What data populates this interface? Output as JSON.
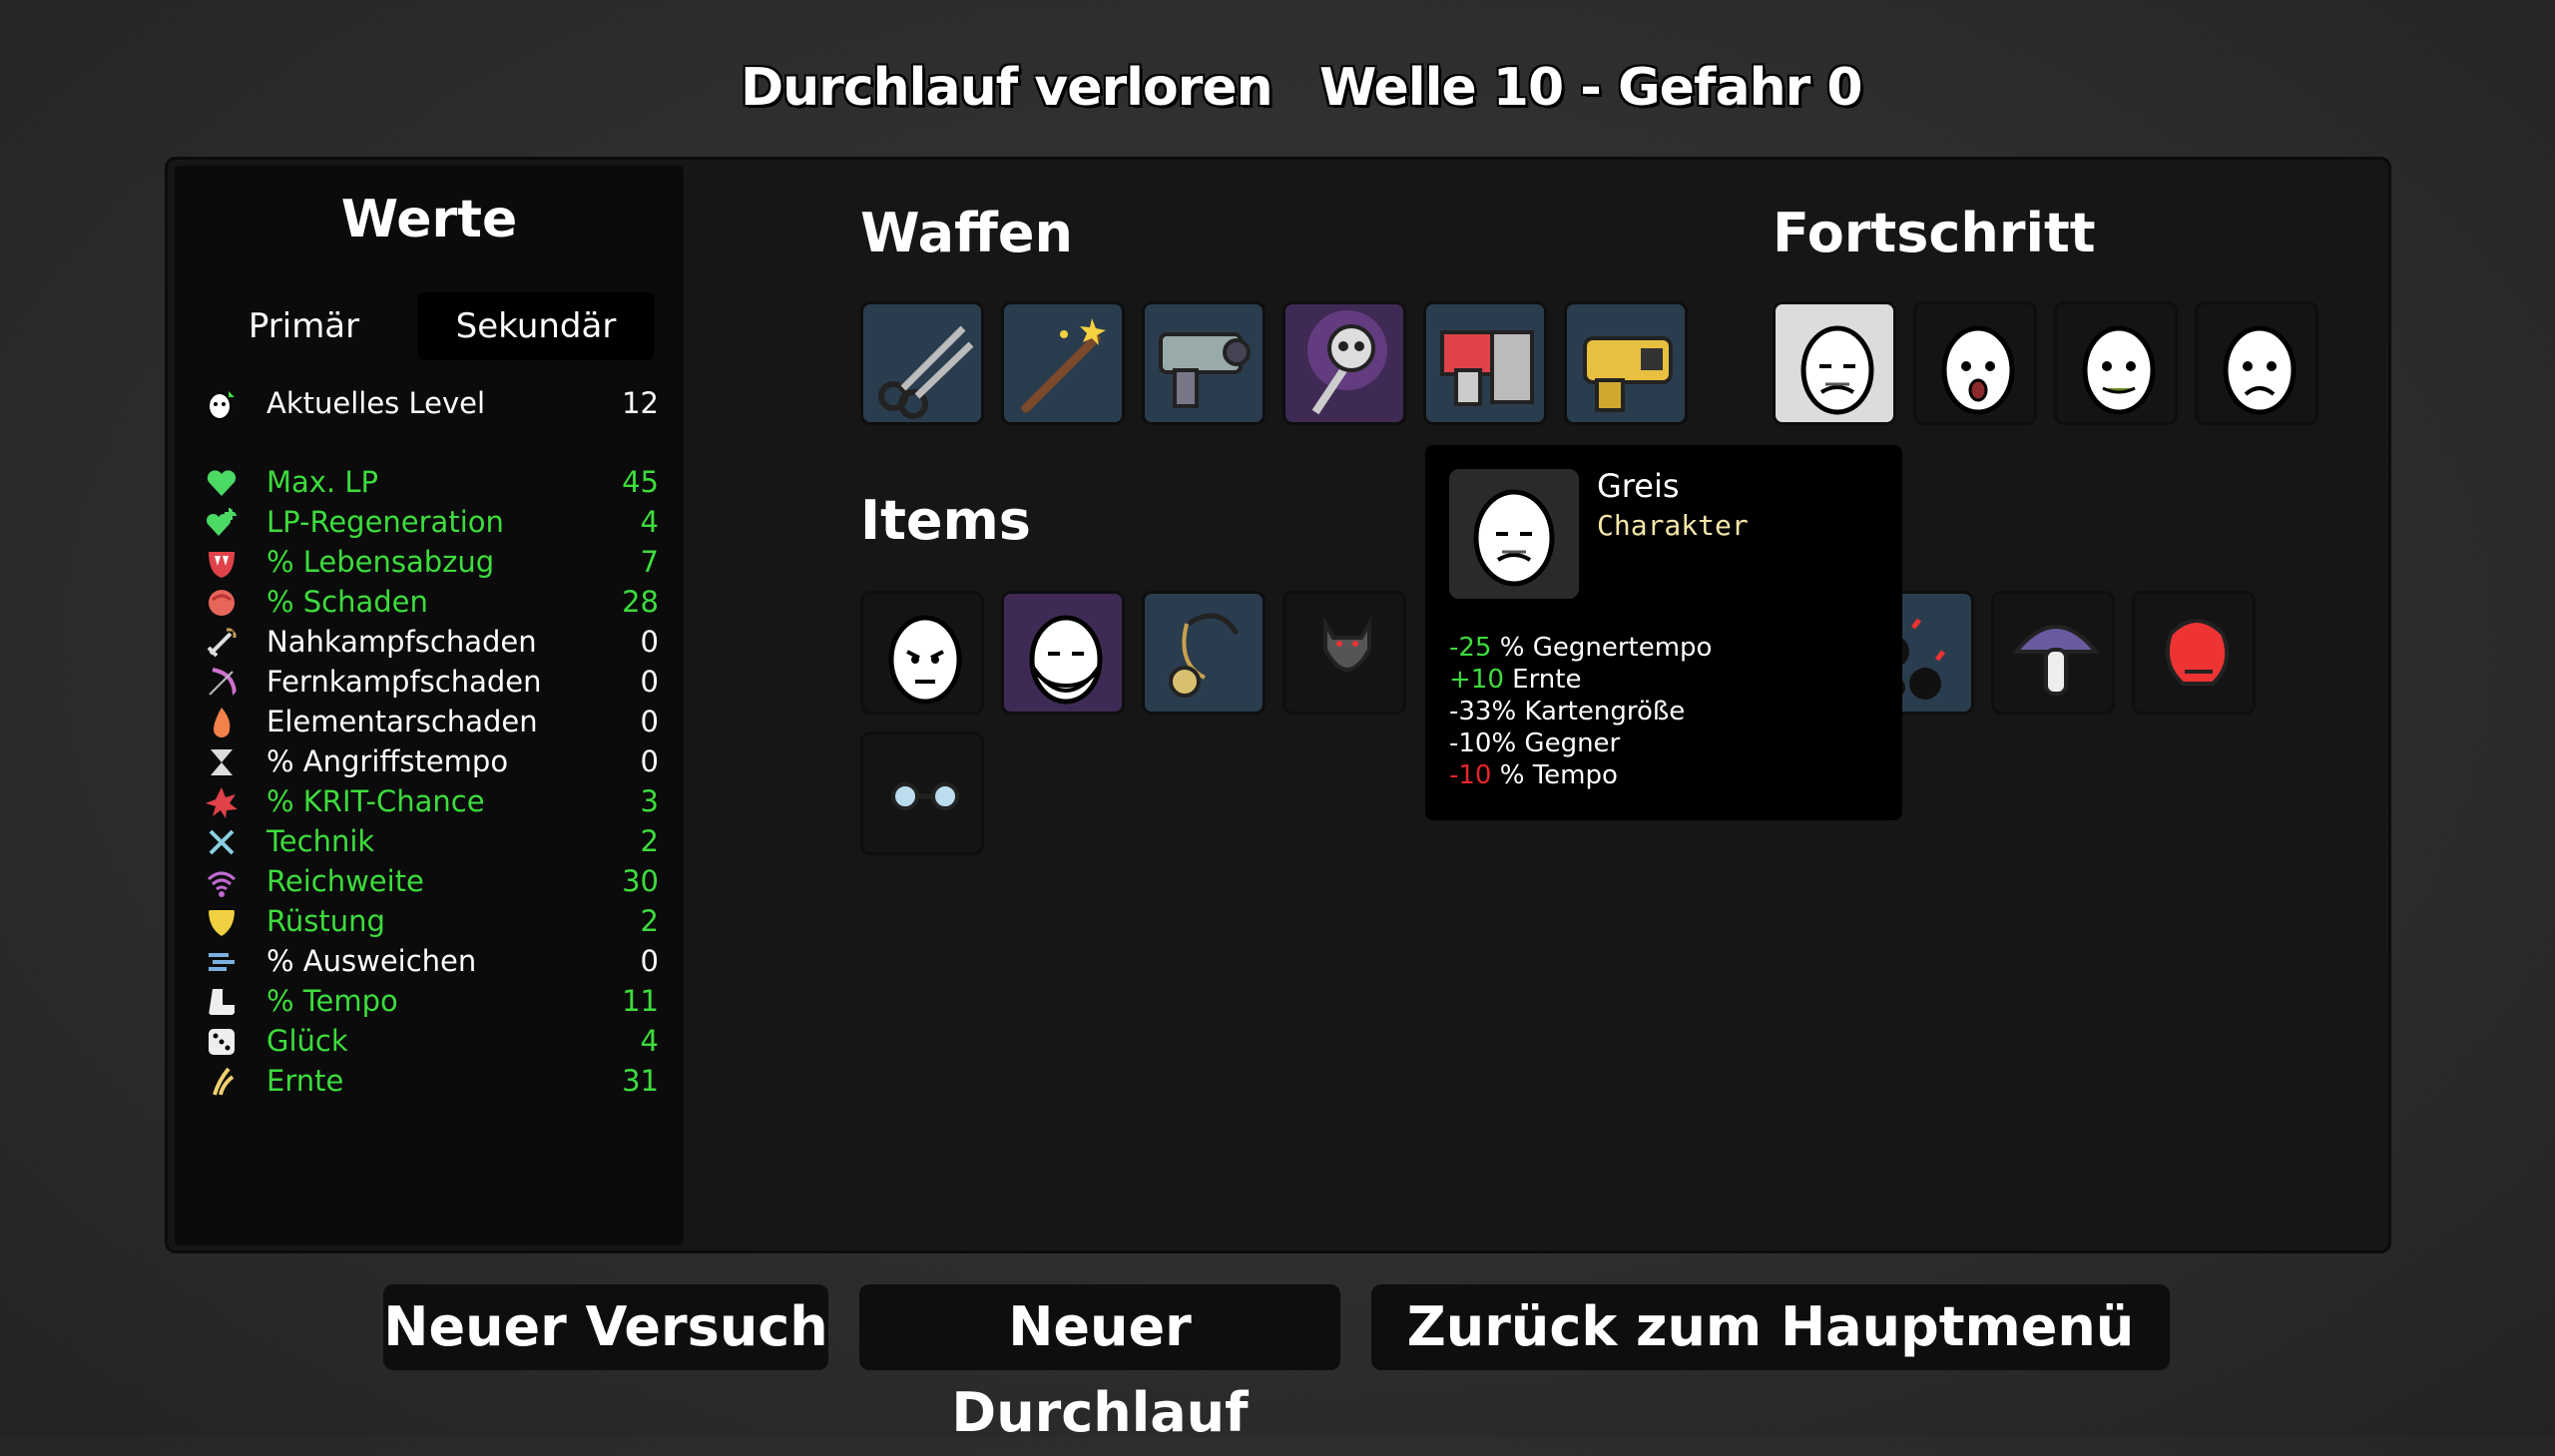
{
  "header": {
    "run_status": "Durchlauf verloren",
    "wave_info": "Welle 10 - Gefahr 0"
  },
  "stats": {
    "title": "Werte",
    "tabs": {
      "primary": "Primär",
      "secondary": "Sekundär"
    },
    "level": {
      "label": "Aktuelles Level",
      "value": "12"
    },
    "rows": [
      {
        "icon": "heart-icon",
        "label": "Max. LP",
        "value": "45",
        "highlight": true
      },
      {
        "icon": "hp-regen-icon",
        "label": "LP-Regeneration",
        "value": "4",
        "highlight": true
      },
      {
        "icon": "fang-icon",
        "label": "% Lebensabzug",
        "value": "7",
        "highlight": true
      },
      {
        "icon": "muscle-icon",
        "label": "% Schaden",
        "value": "28",
        "highlight": true
      },
      {
        "icon": "sword-icon",
        "label": "Nahkampfschaden",
        "value": "0",
        "highlight": false
      },
      {
        "icon": "bow-icon",
        "label": "Fernkampfschaden",
        "value": "0",
        "highlight": false
      },
      {
        "icon": "flame-icon",
        "label": "Elementarschaden",
        "value": "0",
        "highlight": false
      },
      {
        "icon": "hourglass-icon",
        "label": "% Angriffstempo",
        "value": "0",
        "highlight": false
      },
      {
        "icon": "crit-icon",
        "label": "% KRIT-Chance",
        "value": "3",
        "highlight": true
      },
      {
        "icon": "wrench-icon",
        "label": "Technik",
        "value": "2",
        "highlight": true
      },
      {
        "icon": "range-icon",
        "label": "Reichweite",
        "value": "30",
        "highlight": true
      },
      {
        "icon": "shield-icon",
        "label": "Rüstung",
        "value": "2",
        "highlight": true
      },
      {
        "icon": "dodge-icon",
        "label": "% Ausweichen",
        "value": "0",
        "highlight": false
      },
      {
        "icon": "boot-icon",
        "label": "% Tempo",
        "value": "11",
        "highlight": true
      },
      {
        "icon": "dice-icon",
        "label": "Glück",
        "value": "4",
        "highlight": true
      },
      {
        "icon": "harvest-icon",
        "label": "Ernte",
        "value": "31",
        "highlight": true
      }
    ]
  },
  "weapons": {
    "title": "Waffen",
    "items": [
      {
        "icon": "scissors-icon",
        "tier": "blue"
      },
      {
        "icon": "wand-icon",
        "tier": "blue"
      },
      {
        "icon": "blaster-icon",
        "tier": "blue"
      },
      {
        "icon": "skull-staff-icon",
        "tier": "purple"
      },
      {
        "icon": "nail-gun-icon",
        "tier": "blue"
      },
      {
        "icon": "taser-icon",
        "tier": "blue"
      }
    ]
  },
  "progress": {
    "title": "Fortschritt",
    "items": [
      {
        "icon": "old-man-egg-icon",
        "tier": "white"
      },
      {
        "icon": "surprised-egg-icon",
        "tier": "dark"
      },
      {
        "icon": "sick-egg-icon",
        "tier": "dark"
      },
      {
        "icon": "annoyed-egg-icon",
        "tier": "dark"
      }
    ]
  },
  "items": {
    "title": "Items",
    "items": [
      {
        "icon": "grumpy-egg-icon",
        "tier": "dark"
      },
      {
        "icon": "bearded-egg-icon",
        "tier": "purple"
      },
      {
        "icon": "pendant-icon",
        "tier": "blue"
      },
      {
        "icon": "bat-icon",
        "tier": "dark"
      },
      {
        "icon": "goggles-icon",
        "tier": "dark"
      }
    ],
    "extra_items": [
      {
        "icon": "cherry-bomb-icon",
        "tier": "blue"
      },
      {
        "icon": "mushroom-icon",
        "tier": "dark"
      },
      {
        "icon": "boxing-glove-icon",
        "tier": "dark"
      }
    ]
  },
  "tooltip": {
    "name": "Greis",
    "type": "Charakter",
    "icon": "old-man-egg-icon",
    "effects": [
      {
        "amount": "-25",
        "text": " % Gegnertempo",
        "color": "#3ddc3d"
      },
      {
        "amount": "+10",
        "text": " Ernte",
        "color": "#3ddc3d"
      },
      {
        "amount": "",
        "text": "-33% Kartengröße",
        "color": "#ffffff"
      },
      {
        "amount": "",
        "text": "-10% Gegner",
        "color": "#ffffff"
      },
      {
        "amount": "-10",
        "text": " % Tempo",
        "color": "#e5262b"
      }
    ]
  },
  "buttons": {
    "retry": "Neuer Versuch",
    "new_run": "Neuer Durchlauf",
    "main_menu": "Zurück zum Hauptmenü"
  },
  "colors": {
    "positive": "#3ddc3d",
    "negative": "#e5262b",
    "charakter": "#f5e6a8"
  }
}
